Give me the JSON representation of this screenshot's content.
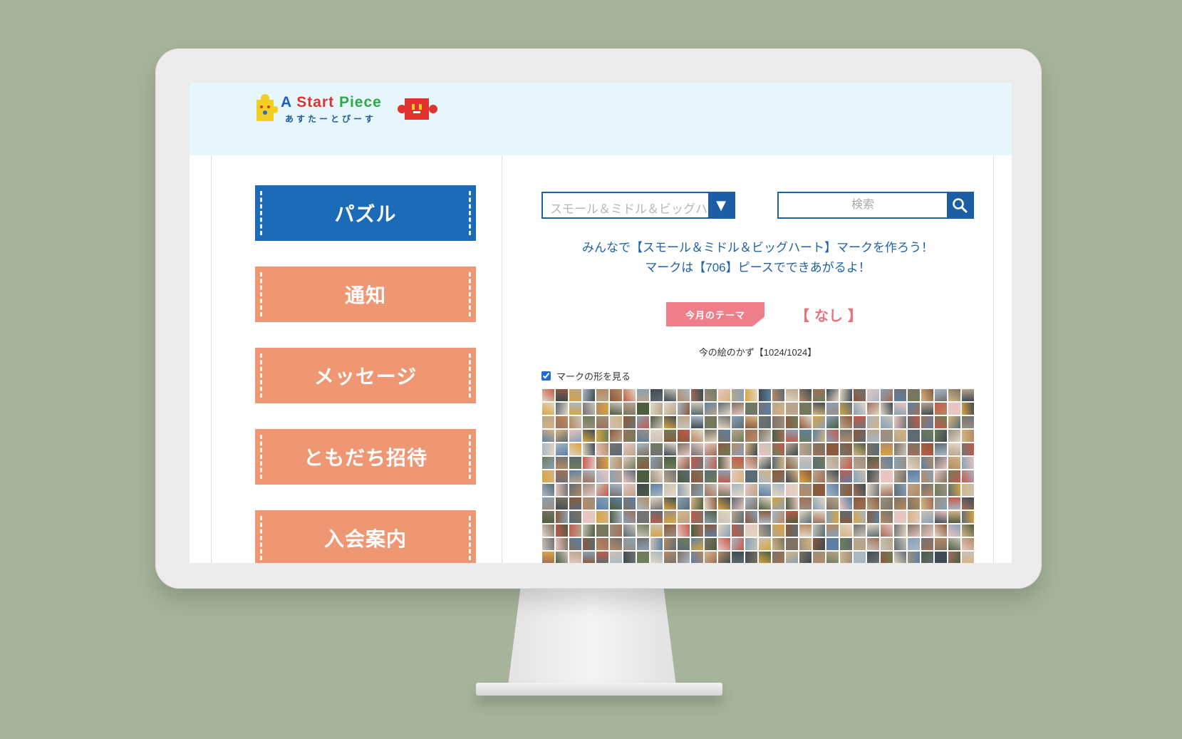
{
  "logo": {
    "title_a": "A",
    "title_start": "Start",
    "title_piece": "Piece",
    "subtitle": "あすたーとぴーす"
  },
  "nav": {
    "items": [
      {
        "label": "パズル",
        "active": true
      },
      {
        "label": "通知",
        "active": false
      },
      {
        "label": "メッセージ",
        "active": false
      },
      {
        "label": "ともだち招待",
        "active": false
      },
      {
        "label": "入会案内",
        "active": false
      }
    ]
  },
  "puzzle_select": {
    "value": "スモール＆ミドル＆ビッグハート"
  },
  "search": {
    "placeholder": "検索"
  },
  "intro": {
    "line1": "みんなで【スモール＆ミドル＆ビッグハート】マークを作ろう！",
    "line2": "マークは【706】ピースでできあがるよ！"
  },
  "theme": {
    "label": "今月のテーマ",
    "value": "【 なし 】"
  },
  "count": {
    "text": "今の絵のかず【1024/1024】"
  },
  "shape_toggle": {
    "label": "マークの形を見る",
    "checked": true
  },
  "colors": {
    "primary": "#1b6bb8",
    "nav_orange": "#ef9673",
    "theme_pink": "#ef7e8b",
    "header_bg": "#e6f6fb",
    "backdrop": "#a7b39b"
  }
}
